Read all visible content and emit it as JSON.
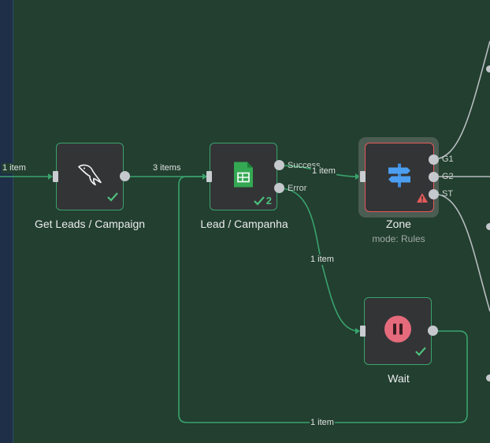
{
  "nodes": {
    "get_leads": {
      "title": "Get Leads / Campaign"
    },
    "lead_campanha": {
      "title": "Lead / Campanha",
      "run_count": "2",
      "outputs": {
        "success": "Success",
        "error": "Error"
      }
    },
    "zone": {
      "title": "Zone",
      "subtitle": "mode: Rules",
      "outputs": {
        "g1": "G1",
        "g2": "G2",
        "st": "ST"
      }
    },
    "wait": {
      "title": "Wait"
    }
  },
  "edges": {
    "incoming": "1 item",
    "leads_to_lead": "3 items",
    "success_to_zone": "1 item",
    "error_to_wait": "1 item",
    "wait_loop": "1 item"
  },
  "colors": {
    "canvas": "#223f30",
    "node_bg": "#333436",
    "success_green": "#3aa36d",
    "error_red": "#e65a5a",
    "wire_grey": "#b8bcc0"
  },
  "icons": {
    "get_leads": "mysql-dolphin-icon",
    "lead_campanha": "google-sheets-icon",
    "zone": "signpost-icon",
    "wait": "pause-icon"
  }
}
